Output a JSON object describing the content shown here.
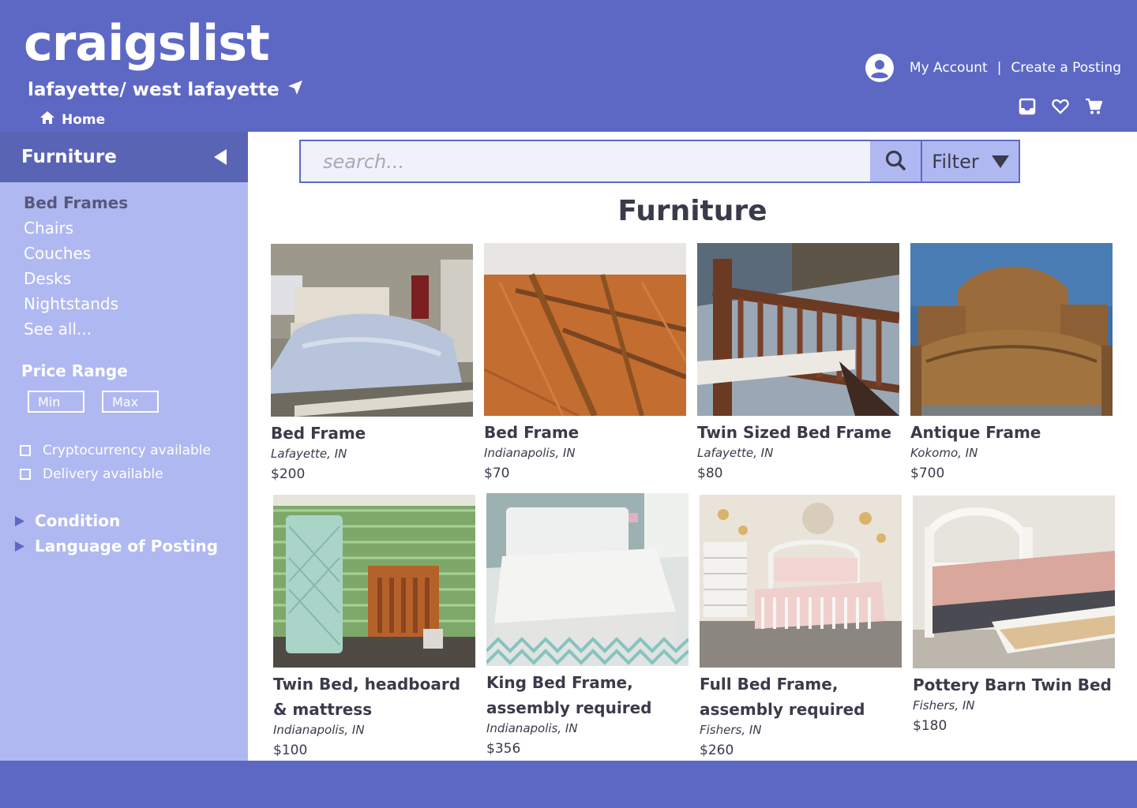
{
  "header": {
    "logo": "craigslist",
    "location": "lafayette/ west lafayette",
    "home": "Home",
    "my_account": "My Account",
    "separator": "|",
    "create_posting": "Create a Posting"
  },
  "search": {
    "placeholder": "search...",
    "filter_label": "Filter"
  },
  "sidebar": {
    "category": "Furniture",
    "subcategories": [
      {
        "label": "Bed Frames",
        "active": true
      },
      {
        "label": "Chairs",
        "active": false
      },
      {
        "label": "Couches",
        "active": false
      },
      {
        "label": "Desks",
        "active": false
      },
      {
        "label": "Nightstands",
        "active": false
      },
      {
        "label": "See all...",
        "active": false
      }
    ],
    "price_range": {
      "label": "Price Range",
      "min_placeholder": "Min",
      "max_placeholder": "Max"
    },
    "checkboxes": [
      {
        "label": "Cryptocurrency available",
        "checked": false
      },
      {
        "label": "Delivery available",
        "checked": false
      }
    ],
    "expanders": [
      "Condition",
      "Language of Posting"
    ]
  },
  "main": {
    "title": "Furniture",
    "listings": [
      {
        "name": "Bed Frame",
        "location": "Lafayette, IN",
        "price": "$200"
      },
      {
        "name": "Bed Frame",
        "location": "Indianapolis, IN",
        "price": "$70"
      },
      {
        "name": "Twin Sized Bed Frame",
        "location": "Lafayette, IN",
        "price": "$80"
      },
      {
        "name": "Antique Frame",
        "location": "Kokomo, IN",
        "price": "$700"
      },
      {
        "name": "Twin Bed, headboard & mattress",
        "location": "Indianapolis, IN",
        "price": "$100"
      },
      {
        "name": "King Bed Frame, assembly required",
        "location": "Indianapolis, IN",
        "price": "$356"
      },
      {
        "name": "Full Bed Frame, assembly required",
        "location": "Fishers, IN",
        "price": "$260"
      },
      {
        "name": "Pottery Barn Twin Bed",
        "location": "Fishers, IN",
        "price": "$180"
      }
    ]
  },
  "colors": {
    "header_bg": "#5d68c4",
    "sidebar_bg": "#b0b8f2",
    "sidebar_head_bg": "#5a64b4",
    "text_dark": "#3a3b4a"
  }
}
